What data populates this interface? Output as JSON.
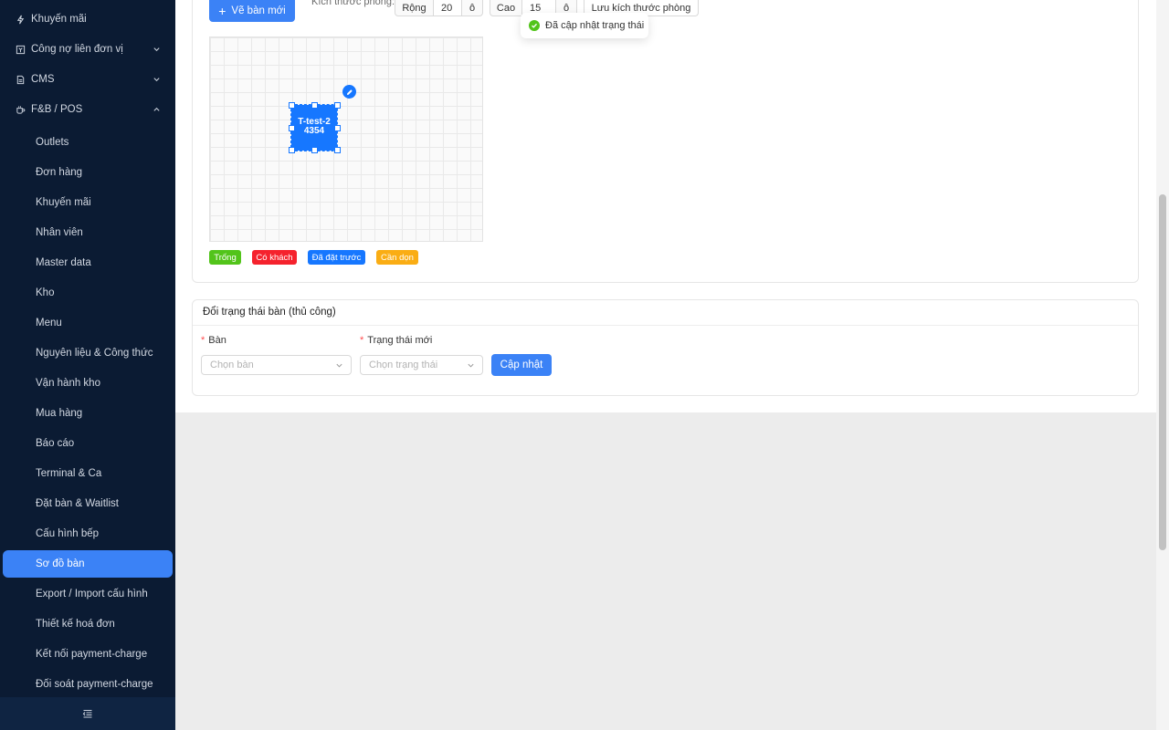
{
  "sidebar": {
    "top_items": [
      {
        "label": "Khuyến mãi",
        "icon": "lightning-icon"
      },
      {
        "label": "Công nợ liên đơn vị",
        "icon": "ledger-icon"
      },
      {
        "label": "CMS",
        "icon": "document-icon"
      },
      {
        "label": "F&B / POS",
        "icon": "cup-icon"
      }
    ],
    "sub_items": [
      {
        "label": "Outlets"
      },
      {
        "label": "Đơn hàng"
      },
      {
        "label": "Khuyến mãi"
      },
      {
        "label": "Nhân viên"
      },
      {
        "label": "Master data"
      },
      {
        "label": "Kho"
      },
      {
        "label": "Menu"
      },
      {
        "label": "Nguyên liệu & Công thức"
      },
      {
        "label": "Vận hành kho"
      },
      {
        "label": "Mua hàng"
      },
      {
        "label": "Báo cáo"
      },
      {
        "label": "Terminal & Ca"
      },
      {
        "label": "Đặt bàn & Waitlist"
      },
      {
        "label": "Cấu hình bếp"
      },
      {
        "label": "Sơ đồ bàn"
      },
      {
        "label": "Export / Import cấu hình"
      },
      {
        "label": "Thiết kế hoá đơn"
      },
      {
        "label": "Kết nối payment-charge"
      },
      {
        "label": "Đối soát payment-charge"
      }
    ],
    "active_item": "Sơ đồ bàn"
  },
  "toolbar": {
    "draw_button": "Vẽ bàn mới",
    "room_size_label": "Kích thước phòng:",
    "width_label": "Rộng",
    "width_value": "20",
    "width_unit": "ô",
    "height_label": "Cao",
    "height_value": "15",
    "height_unit": "ô",
    "save_size_button": "Lưu kích thước phòng"
  },
  "toast": {
    "message": "Đã cập nhật trạng thái"
  },
  "floor_plan": {
    "table_label": "T-test-24354"
  },
  "legend": [
    {
      "label": "Trống",
      "color": "#52c41a"
    },
    {
      "label": "Có khách",
      "color": "#f5222d"
    },
    {
      "label": "Đã đặt trước",
      "color": "#1677ff"
    },
    {
      "label": "Cần dọn",
      "color": "#faad14"
    }
  ],
  "status_form": {
    "title": "Đổi trạng thái bàn (thủ công)",
    "table_label": "Bàn",
    "table_placeholder": "Chọn bàn",
    "status_label": "Trạng thái mới",
    "status_placeholder": "Chọn trạng thái",
    "submit_button": "Cập nhật"
  },
  "colors": {
    "sidebar_bg": "#0b1b33",
    "accent": "#3b82f6",
    "table_blue": "#1677ff",
    "success": "#52c41a"
  }
}
